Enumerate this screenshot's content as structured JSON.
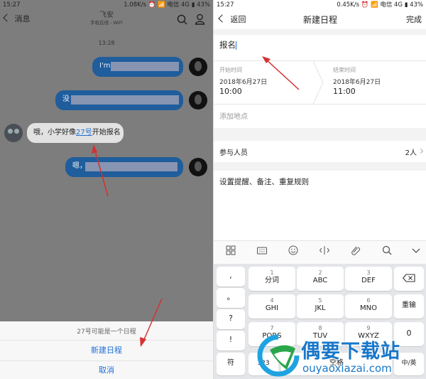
{
  "left": {
    "status": {
      "time": "15:27",
      "right": "1.08K/s ⏰ 📶 电信 4G ▮ 43%"
    },
    "title": {
      "back_label": "消息",
      "name": "飞安",
      "subtitle": "手机在线 - WiFi"
    },
    "timestamp": "13:28",
    "messages": [
      {
        "text": "I'm"
      },
      {
        "text": "没"
      },
      {
        "text_pre": "哦，小学好像",
        "link": "27号",
        "text_post": "开始报名"
      },
      {
        "text": "嗯，"
      }
    ],
    "sheet": {
      "hint": "27号可能是一个日程",
      "action": "新建日程",
      "cancel": "取消"
    }
  },
  "right": {
    "status": {
      "time": "15:27",
      "right": "0.45K/s ⏰ 📶 电信 4G ▮ 43%"
    },
    "nav": {
      "back": "返回",
      "title": "新建日程",
      "done": "完成"
    },
    "event_title": "报名",
    "start": {
      "label": "开始时间",
      "date": "2018年6月27日",
      "time": "10:00"
    },
    "end": {
      "label": "结束时间",
      "date": "2018年6月27日",
      "time": "11:00"
    },
    "location_placeholder": "添加地点",
    "participants": {
      "label": "参与人员",
      "value": "2人"
    },
    "reminder": "设置提醒、备注、重复规则",
    "keyboard": {
      "left_col": [
        ",",
        "。",
        "?",
        "!"
      ],
      "keys": [
        {
          "num": "1",
          "letters": "分词"
        },
        {
          "num": "2",
          "letters": "ABC"
        },
        {
          "num": "3",
          "letters": "DEF"
        },
        {
          "num": "4",
          "letters": "GHI"
        },
        {
          "num": "5",
          "letters": "JKL"
        },
        {
          "num": "6",
          "letters": "MNO"
        },
        {
          "num": "7",
          "letters": "PQRS"
        },
        {
          "num": "8",
          "letters": "TUV"
        },
        {
          "num": "9",
          "letters": "WXYZ"
        }
      ],
      "reenter": "重输",
      "zero": "0",
      "symbol": "符",
      "num_switch": "123",
      "space": "空格",
      "lang": "中/英"
    }
  },
  "watermark": {
    "brand": "偶要下载站",
    "url": "ouyaoxiazai.com"
  },
  "colors": {
    "bubble": "#1f5d9c",
    "link": "#1f6fd6",
    "arrow": "#d63030"
  }
}
